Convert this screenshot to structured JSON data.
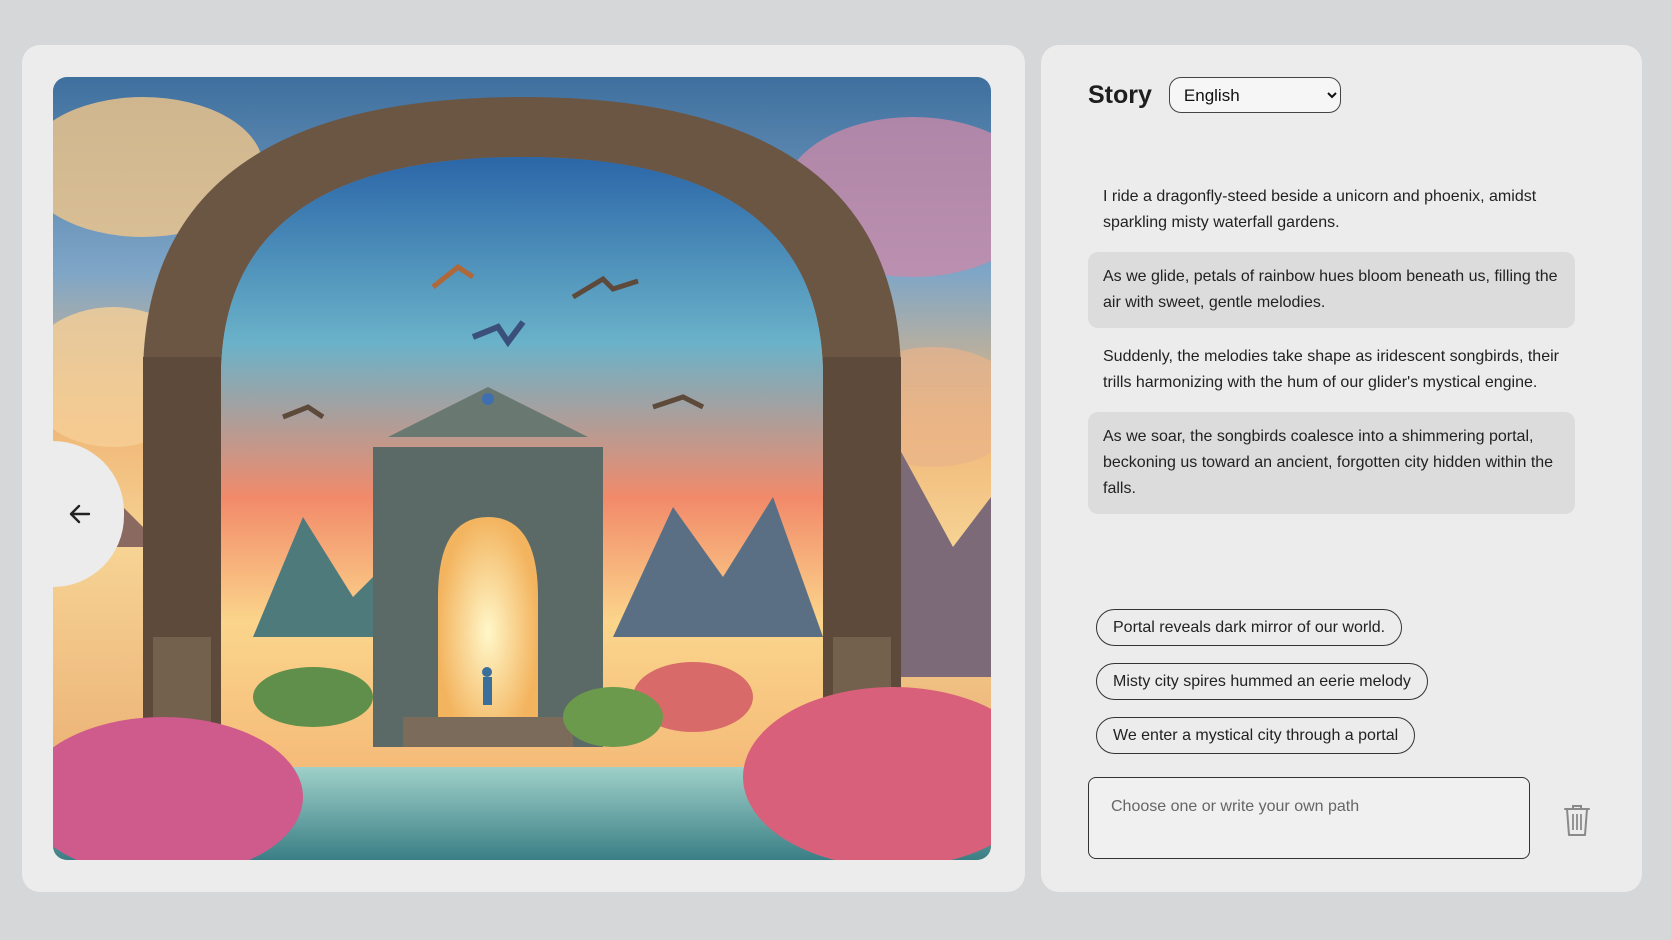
{
  "image_panel": {
    "image_icon": "fantasy-archway-illustration",
    "back_icon": "arrow-left-icon"
  },
  "story": {
    "title": "Story",
    "language": {
      "selected": "English"
    },
    "paragraphs": [
      "I ride a dragonfly-steed beside a unicorn and phoenix, amidst sparkling misty waterfall gardens.",
      "As we glide, petals of rainbow hues bloom beneath us, filling the air with sweet, gentle melodies.",
      "Suddenly, the melodies take shape as iridescent songbirds, their trills harmonizing with the hum of our glider's mystical engine.",
      "As we soar, the songbirds coalesce into a shimmering portal, beckoning us toward an ancient, forgotten city hidden within the falls."
    ],
    "choices": [
      "Portal reveals dark mirror of our world.",
      "Misty city spires hummed an eerie melody",
      "We enter a mystical city through a portal"
    ],
    "input_placeholder": "Choose one or write your own path",
    "trash_icon": "trash-icon"
  }
}
